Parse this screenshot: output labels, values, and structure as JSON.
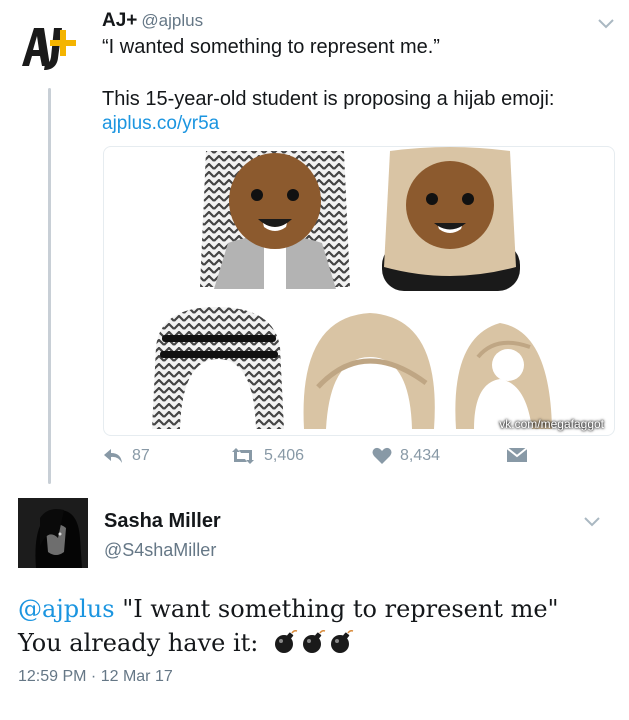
{
  "tweet1": {
    "author_name": "AJ+",
    "author_handle": "@ajplus",
    "quote": "“I wanted something to represent me.”",
    "body": "This 15-year-old student is proposing a hijab emoji:",
    "link": "ajplus.co/yr5a",
    "media_watermark": "vk.com/megafaggot",
    "reply_count": "87",
    "retweet_count": "5,406",
    "like_count": "8,434",
    "icons": [
      "aj-plus-logo",
      "chevron-down-icon",
      "reply-icon",
      "retweet-icon",
      "heart-icon",
      "direct-message-icon"
    ]
  },
  "tweet2": {
    "author_name": "Sasha Miller",
    "author_handle": "@S4shaMiller",
    "mention": "@ajplus",
    "text_line1": " \"I want something to represent me\"",
    "text_line2": "You already have it: ",
    "emoji": [
      "bomb-emoji",
      "bomb-emoji",
      "bomb-emoji"
    ],
    "timestamp": "12:59 PM · 12 Mar 17",
    "icons": [
      "chevron-down-icon"
    ]
  },
  "colors": {
    "link_blue": "#1b95e0",
    "secondary_text": "#657786",
    "action_gray": "#8899a6",
    "thread_line": "#c8cfd6"
  }
}
